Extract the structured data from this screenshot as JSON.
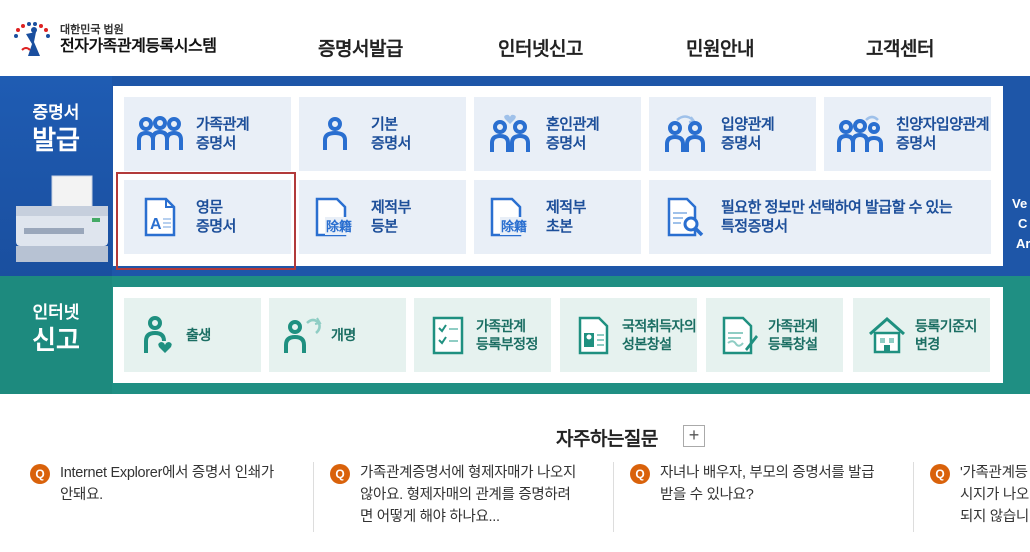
{
  "header": {
    "logo_sub": "대한민국 법원",
    "logo_main": "전자가족관계등록시스템",
    "nav": [
      "증명서발급",
      "인터넷신고",
      "민원안내",
      "고객센터"
    ]
  },
  "issue": {
    "side_title_1": "증명서",
    "side_title_2": "발급",
    "cards": [
      {
        "l1": "가족관계",
        "l2": "증명서",
        "icon": "family-icon"
      },
      {
        "l1": "기본",
        "l2": "증명서",
        "icon": "person-icon"
      },
      {
        "l1": "혼인관계",
        "l2": "증명서",
        "icon": "couple-heart-icon"
      },
      {
        "l1": "입양관계",
        "l2": "증명서",
        "icon": "adoption-icon"
      },
      {
        "l1": "친양자입양관계",
        "l2": "증명서",
        "icon": "full-adoption-icon"
      },
      {
        "l1": "영문",
        "l2": "증명서",
        "icon": "english-document-icon"
      },
      {
        "l1": "제적부",
        "l2": "등본",
        "icon": "removed-register-icon"
      },
      {
        "l1": "제적부",
        "l2": "초본",
        "icon": "removed-register-icon"
      },
      {
        "l1": "필요한 정보만 선택하여 발급할 수 있는",
        "l2": "특정증명서",
        "icon": "document-search-icon"
      }
    ],
    "right_edge": [
      "Ve",
      "C",
      "Ar"
    ],
    "stamp_label": "除籍"
  },
  "report": {
    "side_title_1": "인터넷",
    "side_title_2": "신고",
    "cards": [
      {
        "l1": "출생",
        "l2": "",
        "icon": "birth-icon"
      },
      {
        "l1": "개명",
        "l2": "",
        "icon": "rename-icon"
      },
      {
        "l1": "가족관계",
        "l2": "등록부정정",
        "icon": "checklist-icon"
      },
      {
        "l1": "국적취득자의",
        "l2": "성본창설",
        "icon": "id-card-icon"
      },
      {
        "l1": "가족관계",
        "l2": "등록창설",
        "icon": "document-pen-icon"
      },
      {
        "l1": "등록기준지",
        "l2": "변경",
        "icon": "house-icon"
      }
    ]
  },
  "faq": {
    "title": "자주하는질문",
    "plus": "+",
    "q_badge": "Q",
    "items": [
      {
        "lines": [
          "Internet Explorer에서 증명서 인쇄가",
          "안돼요."
        ]
      },
      {
        "lines": [
          "가족관계증명서에 형제자매가 나오지",
          "않아요. 형제자매의 관계를 증명하려",
          "면 어떻게 해야 하나요..."
        ]
      },
      {
        "lines": [
          "자녀나 배우자, 부모의 증명서를 발급",
          "받을 수 있나요?"
        ]
      },
      {
        "lines": [
          "'가족관계등",
          "시지가 나오",
          "되지 않습니"
        ]
      }
    ]
  },
  "colors": {
    "issue_band": "#1e56a8",
    "report_band": "#1f8f83",
    "issue_card": "#e9eff7",
    "report_card": "#e6f2ef",
    "issue_text": "#1d4f9a",
    "report_text": "#1b6e63",
    "faq_badge": "#d9620b",
    "selection": "#b23a3a"
  }
}
